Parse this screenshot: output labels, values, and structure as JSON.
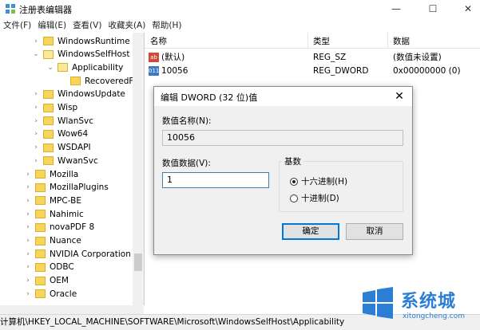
{
  "window": {
    "title": "注册表编辑器",
    "controls": {
      "minimize": "—",
      "maximize": "☐",
      "close": "✕"
    }
  },
  "menu": [
    "文件(F)",
    "编辑(E)",
    "查看(V)",
    "收藏夹(A)",
    "帮助(H)"
  ],
  "tree": {
    "items": [
      {
        "label": "WindowsRuntime",
        "level": 1,
        "expanded": false
      },
      {
        "label": "WindowsSelfHost",
        "level": 1,
        "expanded": true
      },
      {
        "label": "Applicability",
        "level": 2,
        "expanded": true
      },
      {
        "label": "RecoveredFr",
        "level": 3,
        "expanded": false
      },
      {
        "label": "WindowsUpdate",
        "level": 1,
        "expanded": false
      },
      {
        "label": "Wisp",
        "level": 1,
        "expanded": false
      },
      {
        "label": "WlanSvc",
        "level": 1,
        "expanded": false
      },
      {
        "label": "Wow64",
        "level": 1,
        "expanded": false
      },
      {
        "label": "WSDAPI",
        "level": 1,
        "expanded": false
      },
      {
        "label": "WwanSvc",
        "level": 1,
        "expanded": false
      },
      {
        "label": "Mozilla",
        "level": 0,
        "expanded": false
      },
      {
        "label": "MozillaPlugins",
        "level": 0,
        "expanded": false
      },
      {
        "label": "MPC-BE",
        "level": 0,
        "expanded": false
      },
      {
        "label": "Nahimic",
        "level": 0,
        "expanded": false
      },
      {
        "label": "novaPDF 8",
        "level": 0,
        "expanded": false
      },
      {
        "label": "Nuance",
        "level": 0,
        "expanded": false
      },
      {
        "label": "NVIDIA Corporation",
        "level": 0,
        "expanded": false
      },
      {
        "label": "ODBC",
        "level": 0,
        "expanded": false
      },
      {
        "label": "OEM",
        "level": 0,
        "expanded": false
      },
      {
        "label": "Oracle",
        "level": 0,
        "expanded": false
      }
    ]
  },
  "list": {
    "columns": [
      "名称",
      "类型",
      "数据"
    ],
    "rows": [
      {
        "name": "(默认)",
        "type": "REG_SZ",
        "data": "(数值未设置)",
        "icon": "string-value-icon"
      },
      {
        "name": "10056",
        "type": "REG_DWORD",
        "data": "0x00000000 (0)",
        "icon": "dword-value-icon"
      }
    ]
  },
  "dialog": {
    "title": "编辑 DWORD (32 位)值",
    "value_name_label": "数值名称(N):",
    "value_name": "10056",
    "value_data_label": "数值数据(V):",
    "value_data": "1",
    "base_label": "基数",
    "radio_hex": "十六进制(H)",
    "radio_dec": "十进制(D)",
    "selected_base": "hex",
    "ok": "确定",
    "cancel": "取消",
    "close": "✕"
  },
  "statusbar": {
    "path": "计算机\\HKEY_LOCAL_MACHINE\\SOFTWARE\\Microsoft\\WindowsSelfHost\\Applicability"
  },
  "watermark": {
    "brand": "系统城",
    "url": "xitongcheng.com"
  },
  "colors": {
    "folder": "#f6d55a",
    "accent": "#0078d7",
    "watermark": "#2a7fd4"
  }
}
